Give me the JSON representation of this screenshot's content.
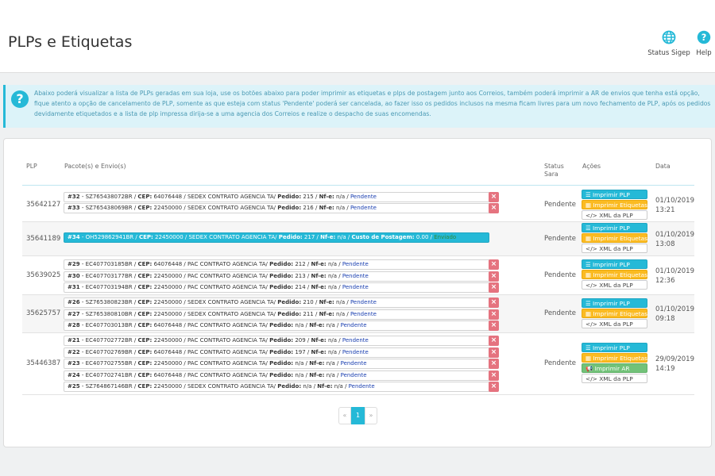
{
  "header": {
    "title": "PLPs e Etiquetas",
    "status_sigep_label": "Status Sigep",
    "help_label": "Help"
  },
  "alert": {
    "text": "Abaixo poderá visualizar a lista de PLPs geradas em sua loja, use os botões abaixo para poder imprimir as etiquetas e plps de postagem junto aos Correios, também poderá imprimir a AR de envios que tenha está opção, fique atento a opção de cancelamento de PLP, somente as que esteja com status 'Pendente' poderá ser cancelada, ao fazer isso os pedidos inclusos na mesma ficam livres para um novo fechamento de PLP, após os pedidos devidamente etiquetados e a lista de plp impressa dirija-se a uma agencia dos Correios e realize o despacho de suas encomendas."
  },
  "table": {
    "columns": {
      "plp": "PLP",
      "pacotes": "Pacote(s) e Envio(s)",
      "status_1": "Status",
      "status_2": "Sara",
      "acoes": "Ações",
      "data": "Data"
    },
    "labels": {
      "cep": "CEP:",
      "pedido": "Pedido:",
      "nfe": "Nf-e:",
      "custo": "Custo de Postagem:",
      "delete_glyph": "×"
    },
    "actions": {
      "imprimir_plp": "Imprimir PLP",
      "imprimir_etiquetas": "Imprimir Etiquetas",
      "imprimir_ar": "Imprimir AR",
      "xml": "XML da PLP"
    },
    "rows": [
      {
        "plp": "35642127",
        "status": "Pendente",
        "date": "01/10/2019",
        "time": "13:21",
        "packages": [
          {
            "num": "#32",
            "code": "SZ765438072BR",
            "cep": "64076448",
            "service": "SEDEX CONTRATO AGENCIA TA/",
            "pedido": "215",
            "nfe": "n/a",
            "status": "Pendente"
          },
          {
            "num": "#33",
            "code": "SZ765438069BR",
            "cep": "22450000",
            "service": "SEDEX CONTRATO AGENCIA TA/",
            "pedido": "216",
            "nfe": "n/a",
            "status": "Pendente"
          }
        ]
      },
      {
        "plp": "35641189",
        "status": "Pendente",
        "date": "01/10/2019",
        "time": "13:08",
        "packages": [
          {
            "num": "#34",
            "code": "OH529862941BR",
            "cep": "22450000",
            "service": "SEDEX CONTRATO AGENCIA TA/",
            "pedido": "217",
            "nfe": "n/a",
            "custo": "0.00",
            "status": "Enviado"
          }
        ]
      },
      {
        "plp": "35639025",
        "status": "Pendente",
        "date": "01/10/2019",
        "time": "12:36",
        "packages": [
          {
            "num": "#29",
            "code": "EC407703185BR",
            "cep": "64076448",
            "service": "PAC CONTRATO AGENCIA TA/",
            "pedido": "212",
            "nfe": "n/a",
            "status": "Pendente"
          },
          {
            "num": "#30",
            "code": "EC407703177BR",
            "cep": "22450000",
            "service": "PAC CONTRATO AGENCIA TA/",
            "pedido": "213",
            "nfe": "n/a",
            "status": "Pendente"
          },
          {
            "num": "#31",
            "code": "EC407703194BR",
            "cep": "22450000",
            "service": "PAC CONTRATO AGENCIA TA/",
            "pedido": "214",
            "nfe": "n/a",
            "status": "Pendente"
          }
        ]
      },
      {
        "plp": "35625757",
        "status": "Pendente",
        "date": "01/10/2019",
        "time": "09:18",
        "packages": [
          {
            "num": "#26",
            "code": "SZ765380823BR",
            "cep": "22450000",
            "service": "SEDEX CONTRATO AGENCIA TA/",
            "pedido": "210",
            "nfe": "n/a",
            "status": "Pendente"
          },
          {
            "num": "#27",
            "code": "SZ765380810BR",
            "cep": "22450000",
            "service": "SEDEX CONTRATO AGENCIA TA/",
            "pedido": "211",
            "nfe": "n/a",
            "status": "Pendente"
          },
          {
            "num": "#28",
            "code": "EC407703013BR",
            "cep": "64076448",
            "service": "PAC CONTRATO AGENCIA TA/",
            "pedido": "n/a",
            "nfe": "n/a",
            "status": "Pendente"
          }
        ]
      },
      {
        "plp": "35446387",
        "status": "Pendente",
        "date": "29/09/2019",
        "time": "14:19",
        "packages": [
          {
            "num": "#21",
            "code": "EC407702772BR",
            "cep": "22450000",
            "service": "PAC CONTRATO AGENCIA TA/",
            "pedido": "209",
            "nfe": "n/a",
            "status": "Pendente"
          },
          {
            "num": "#22",
            "code": "EC407702769BR",
            "cep": "64076448",
            "service": "PAC CONTRATO AGENCIA TA/",
            "pedido": "197",
            "nfe": "n/a",
            "status": "Pendente"
          },
          {
            "num": "#23",
            "code": "EC407702755BR",
            "cep": "22450000",
            "service": "PAC CONTRATO AGENCIA TA/",
            "pedido": "n/a",
            "nfe": "n/a",
            "status": "Pendente"
          },
          {
            "num": "#24",
            "code": "EC407702741BR",
            "cep": "64076448",
            "service": "PAC CONTRATO AGENCIA TA/",
            "pedido": "n/a",
            "nfe": "n/a",
            "status": "Pendente"
          },
          {
            "num": "#25",
            "code": "SZ764867146BR",
            "cep": "22450000",
            "service": "SEDEX CONTRATO AGENCIA TA/",
            "pedido": "n/a",
            "nfe": "n/a",
            "status": "Pendente"
          }
        ]
      }
    ]
  },
  "pagination": {
    "prev": "«",
    "current": "1",
    "next": "»"
  },
  "colors": {
    "accent": "#25b9d7",
    "warning": "#fbbb22",
    "success": "#72c279",
    "danger": "#e5737f"
  }
}
